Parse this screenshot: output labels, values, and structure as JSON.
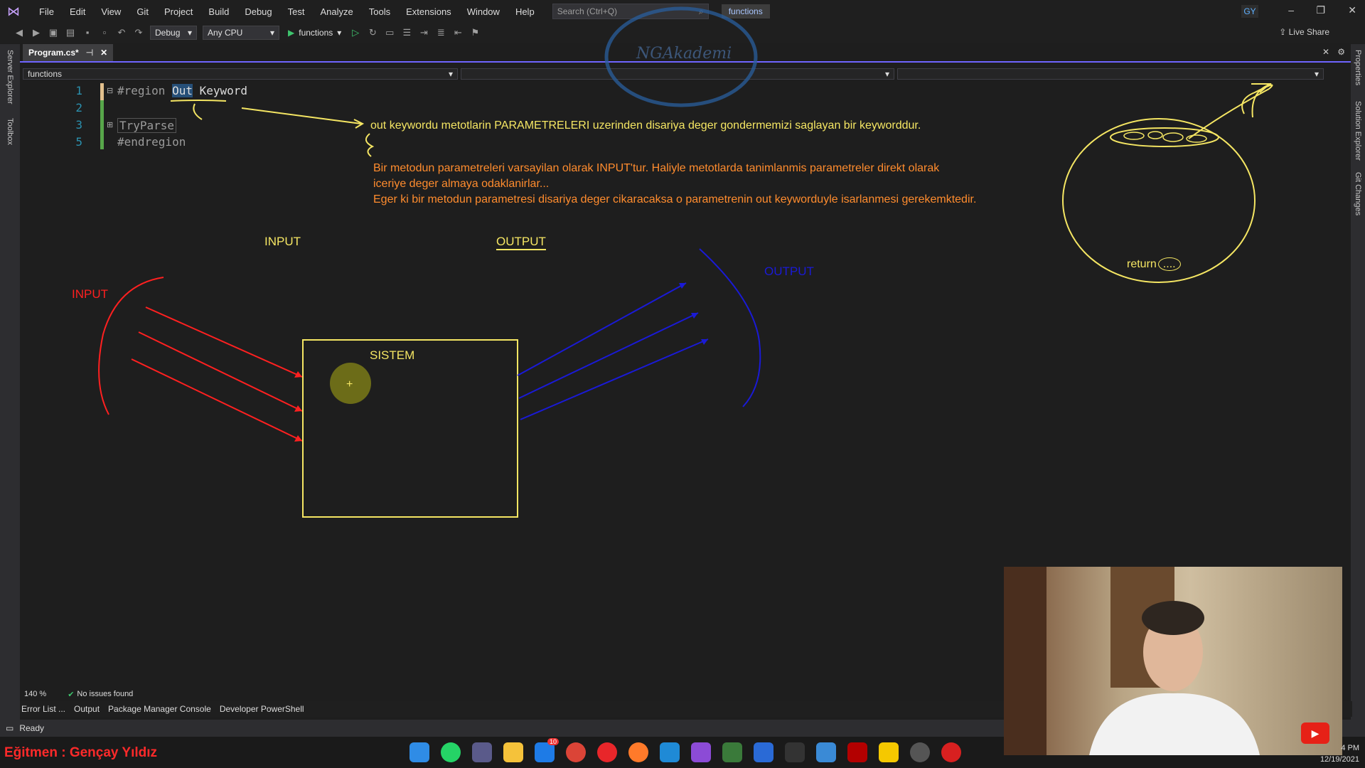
{
  "menu": [
    "File",
    "Edit",
    "View",
    "Git",
    "Project",
    "Build",
    "Debug",
    "Test",
    "Analyze",
    "Tools",
    "Extensions",
    "Window",
    "Help"
  ],
  "search": {
    "placeholder": "Search (Ctrl+Q)"
  },
  "solution_name": "functions",
  "user_initials": "GY",
  "toolbar": {
    "config": "Debug",
    "platform": "Any CPU",
    "run_target": "functions",
    "live_share": "Live Share"
  },
  "left_rail": [
    "Server Explorer",
    "Toolbox"
  ],
  "right_rail": [
    "Properties",
    "Solution Explorer",
    "Git Changes"
  ],
  "tab": {
    "label": "Program.cs*"
  },
  "nav": {
    "scope": "functions"
  },
  "code": {
    "line_numbers": [
      "1",
      "2",
      "3",
      "5"
    ],
    "line1_a": "#region ",
    "line1_sel": "Out",
    "line1_b": " Keyword",
    "line3": "TryParse",
    "line5": "#endregion"
  },
  "annotations": {
    "note1": "out keywordu metotlarin PARAMETRELERI uzerinden disariya deger gondermemizi saglayan bir keyworddur.",
    "note2a": "Bir metodun parametreleri varsayilan olarak INPUT'tur. Haliyle metotlarda tanimlanmis parametreler direkt olarak",
    "note2b": "iceriye deger almaya odaklanirlar...",
    "note3": "Eger ki bir metodun parametresi disariya deger cikaracaksa o parametrenin out keyworduyle isarlanmesi gerekemktedir.",
    "input_top": "INPUT",
    "output_top": "OUTPUT",
    "input_red": "INPUT",
    "output_blue": "OUTPUT",
    "system": "SISTEM",
    "return_label": "return",
    "return_dots": "....",
    "watermark": "NGAkademi"
  },
  "colors": {
    "yellow": "#f5e663",
    "orange": "#ff8c2e",
    "red": "#ff2020",
    "blue": "#1a1ad6",
    "accent": "#6f64ff"
  },
  "status": {
    "zoom": "140 %",
    "issues": "No issues found",
    "ready": "Ready"
  },
  "bottom_tabs": [
    "Error List ...",
    "Output",
    "Package Manager Console",
    "Developer PowerShell"
  ],
  "instructor": "Eğitmen : Gençay Yıldız",
  "clock": {
    "time": "4 PM",
    "date": "12/19/2021"
  },
  "taskbar_badge": "10"
}
